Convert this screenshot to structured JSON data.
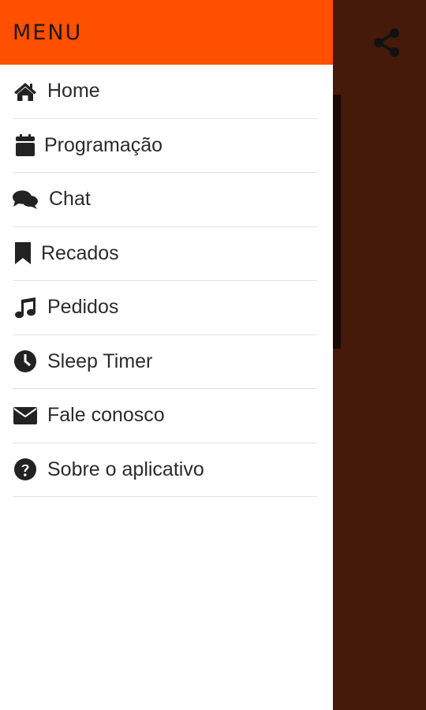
{
  "drawer": {
    "title": "MENU",
    "header_color": "#ff4f00",
    "items": [
      {
        "label": "Home",
        "icon": "home-icon"
      },
      {
        "label": "Programação",
        "icon": "calendar-icon"
      },
      {
        "label": "Chat",
        "icon": "chat-bubbles-icon"
      },
      {
        "label": "Recados",
        "icon": "bookmark-icon"
      },
      {
        "label": "Pedidos",
        "icon": "music-note-icon"
      },
      {
        "label": "Sleep Timer",
        "icon": "clock-icon"
      },
      {
        "label": "Fale conosco",
        "icon": "envelope-icon"
      },
      {
        "label": "Sobre o aplicativo",
        "icon": "question-circle-icon"
      }
    ]
  },
  "toolbar": {
    "share_icon": "share-icon",
    "background_color": "#451a0a"
  }
}
